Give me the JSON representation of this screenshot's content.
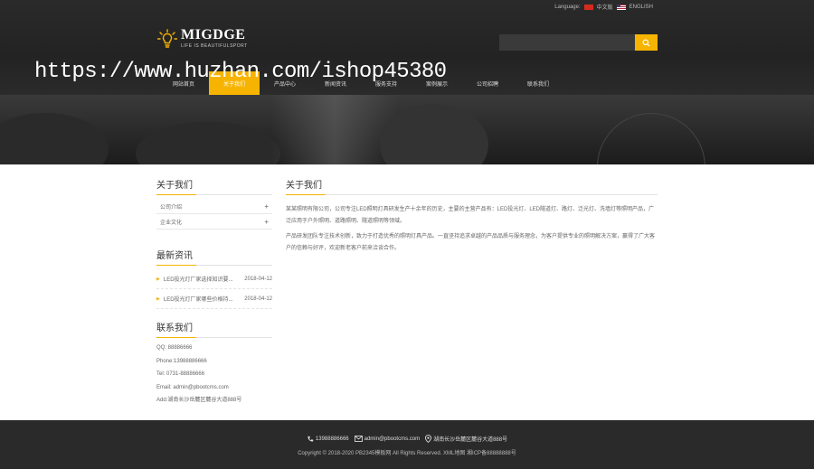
{
  "header": {
    "language_label": "Language:",
    "lang_cn": "中文版",
    "lang_en": "ENGLISH",
    "brand_name": "MIGDGE",
    "slogan": "LIFE IS BEAUTIFULSPORT",
    "search_placeholder": "",
    "watermark": "https://www.huzhan.com/ishop45380"
  },
  "nav": [
    "网站首页",
    "关于我们",
    "产品中心",
    "新闻资讯",
    "服务支持",
    "案例展示",
    "公司招聘",
    "联系我们"
  ],
  "sidebar": {
    "about_title": "关于我们",
    "about_items": [
      "公司介绍",
      "企业文化"
    ],
    "news_title": "最新资讯",
    "news_items": [
      {
        "title": "LED投光灯厂家选择知识要...",
        "date": "2018-04-12"
      },
      {
        "title": "LED投光灯厂家哪些价格持...",
        "date": "2018-04-12"
      }
    ],
    "contact_title": "联系我们",
    "contact": [
      "QQ: 88886666",
      "Phone:13988886666",
      "Tel: 0731-88886666",
      "Email: admin@pbootcms.com",
      "Add:湖南长沙岳麓区麓谷大道888号"
    ]
  },
  "main": {
    "title": "关于我们",
    "paragraphs": [
      "某某照明有限公司，公司专注LED照明灯具研发生产十余年的历史，主要的主营产品有：LED投光灯、LED隧道灯、路灯、泛光灯、洗墙灯等照明产品，广泛应用于户外照明、道路照明、隧道照明等领域。",
      "产品研发团队专注技术创新，致力于打造优秀的照明灯具产品。一直坚持追求卓越的产品品质与服务理念，为客户提供专业的照明解决方案，赢得了广大客户的信赖与好评，欢迎新老客户前来洽谈合作。"
    ]
  },
  "footer": {
    "phone": "13988886666",
    "email": "admin@pbootcms.com",
    "address": "湖南长沙岳麓区麓谷大道888号",
    "copyright": "Copyright © 2018-2020 PB2345模板网 All Rights Reserved.  XML地图  湘ICP备88888888号"
  },
  "colors": {
    "accent": "#f6b400",
    "header_bg": "#2a2a2a",
    "footer_bg": "#2a2a2a"
  }
}
